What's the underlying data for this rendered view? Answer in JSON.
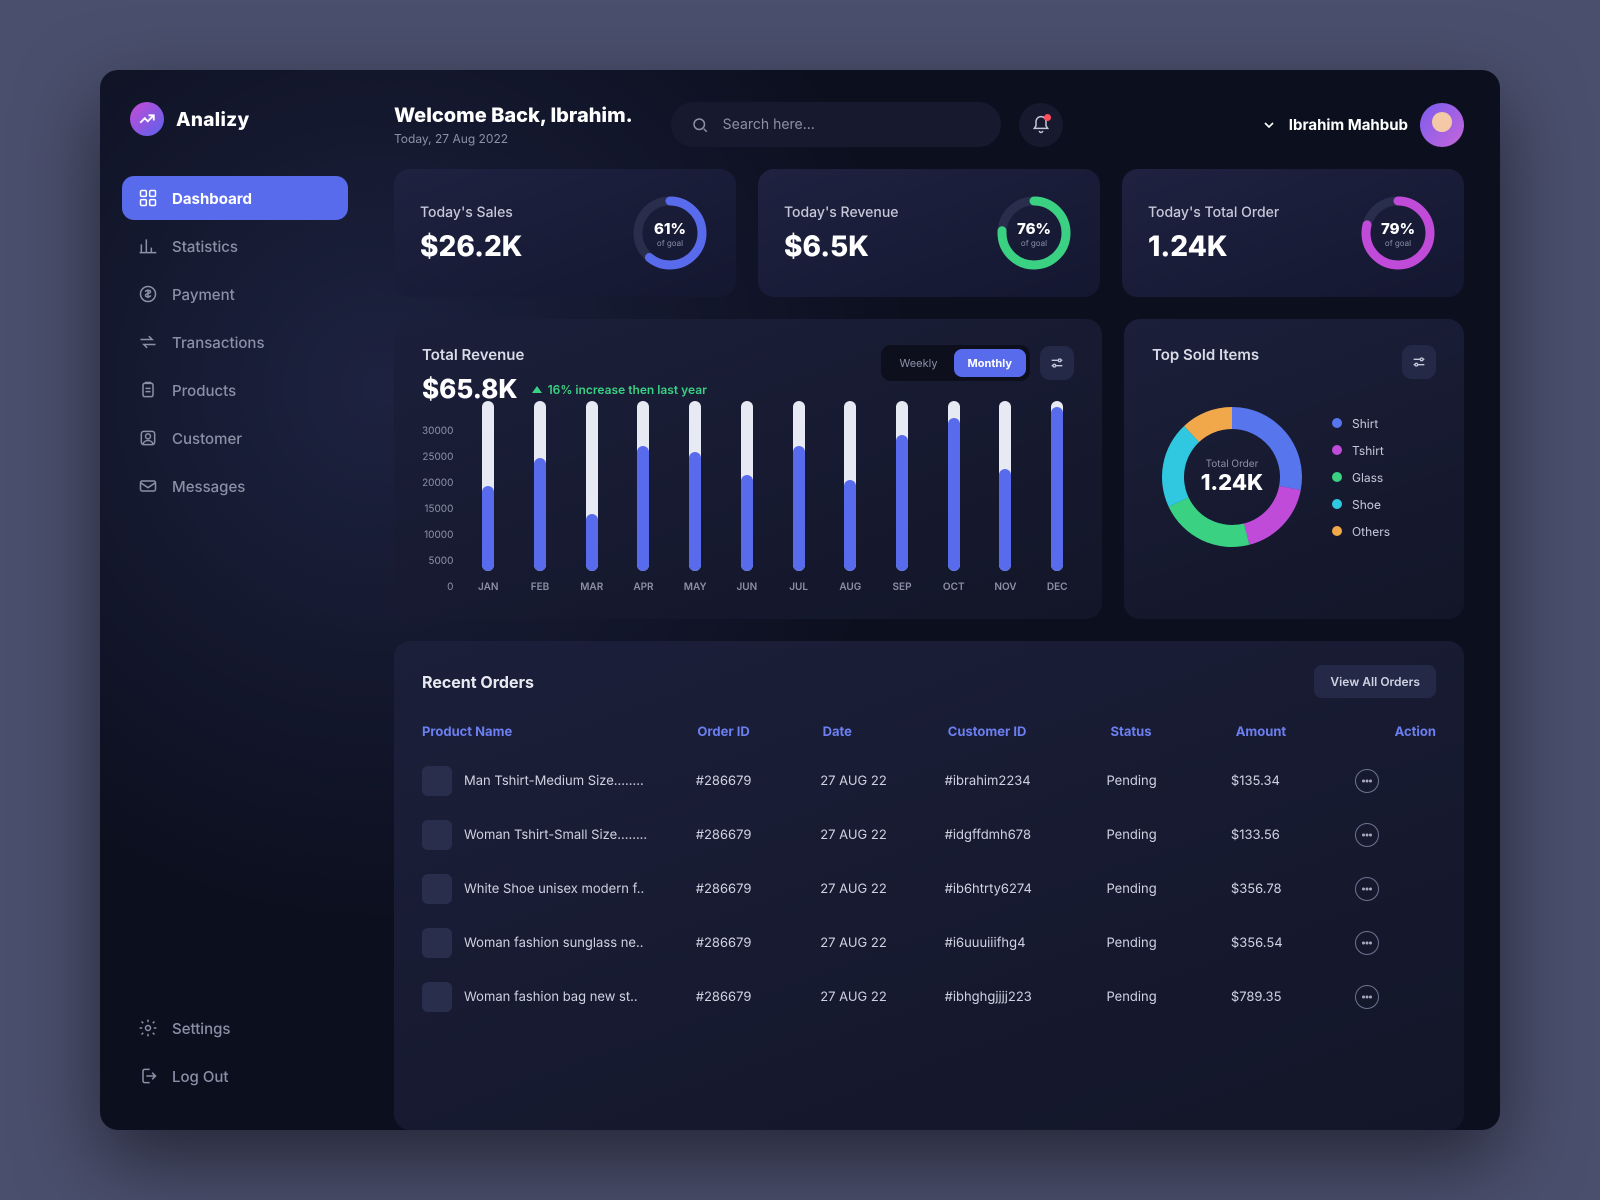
{
  "brand": "Analizy",
  "sidebar": {
    "items": [
      {
        "label": "Dashboard",
        "icon": "grid"
      },
      {
        "label": "Statistics",
        "icon": "stats"
      },
      {
        "label": "Payment",
        "icon": "dollar"
      },
      {
        "label": "Transactions",
        "icon": "swap"
      },
      {
        "label": "Products",
        "icon": "clipboard"
      },
      {
        "label": "Customer",
        "icon": "user"
      },
      {
        "label": "Messages",
        "icon": "mail"
      }
    ],
    "bottom": [
      {
        "label": "Settings",
        "icon": "gear"
      },
      {
        "label": "Log Out",
        "icon": "logout"
      }
    ]
  },
  "header": {
    "welcome": "Welcome Back, Ibrahim.",
    "date": "Today, 27 Aug 2022",
    "search_placeholder": "Search here...",
    "username": "Ibrahim Mahbub"
  },
  "stats": [
    {
      "label": "Today's Sales",
      "value": "$26.2K",
      "pct": "61%",
      "sub": "of goal",
      "color": "#586bed"
    },
    {
      "label": "Today's Revenue",
      "value": "$6.5K",
      "pct": "76%",
      "sub": "of goal",
      "color": "#3ad183"
    },
    {
      "label": "Today's Total Order",
      "value": "1.24K",
      "pct": "79%",
      "sub": "of goal",
      "color": "#c14bd9"
    }
  ],
  "revenue": {
    "title": "Total Revenue",
    "value": "$65.8K",
    "trend": "16% increase then last year",
    "toggle": [
      "Weekly",
      "Monthly"
    ]
  },
  "top_sold": {
    "title": "Top Sold Items",
    "center_label": "Total Order",
    "center_value": "1.24K",
    "legend": [
      {
        "label": "Shirt",
        "color": "#5775ed"
      },
      {
        "label": "Tshirt",
        "color": "#c14bd9"
      },
      {
        "label": "Glass",
        "color": "#3ad183"
      },
      {
        "label": "Shoe",
        "color": "#30c8e0"
      },
      {
        "label": "Others",
        "color": "#f0a84a"
      }
    ]
  },
  "orders": {
    "title": "Recent Orders",
    "view_all": "View All Orders",
    "columns": [
      "Product Name",
      "Order ID",
      "Date",
      "Customer ID",
      "Status",
      "Amount",
      "Action"
    ],
    "rows": [
      {
        "product": "Man Tshirt-Medium Size........",
        "id": "#286679",
        "date": "27 AUG 22",
        "cust": "#ibrahim2234",
        "status": "Pending",
        "amount": "$135.34"
      },
      {
        "product": "Woman Tshirt-Small Size........",
        "id": "#286679",
        "date": "27 AUG 22",
        "cust": "#idgffdmh678",
        "status": "Pending",
        "amount": "$133.56"
      },
      {
        "product": "White Shoe unisex modern f..",
        "id": "#286679",
        "date": "27 AUG 22",
        "cust": "#ib6htrty6274",
        "status": "Pending",
        "amount": "$356.78"
      },
      {
        "product": "Woman fashion sunglass ne..",
        "id": "#286679",
        "date": "27 AUG 22",
        "cust": "#i6uuuiiifhg4",
        "status": "Pending",
        "amount": "$356.54"
      },
      {
        "product": "Woman fashion bag new st..",
        "id": "#286679",
        "date": "27 AUG 22",
        "cust": "#ibhghgjjjj223",
        "status": "Pending",
        "amount": "$789.35"
      }
    ]
  },
  "chart_data": [
    {
      "type": "bar",
      "title": "Total Revenue",
      "ylabel": "",
      "ylim": [
        0,
        30000
      ],
      "yticks": [
        0,
        5000,
        10000,
        15000,
        20000,
        25000,
        30000
      ],
      "categories": [
        "JAN",
        "FEB",
        "MAR",
        "APR",
        "MAY",
        "JUN",
        "JUL",
        "AUG",
        "SEP",
        "OCT",
        "NOV",
        "DEC"
      ],
      "values": [
        15000,
        20000,
        10000,
        22000,
        21000,
        17000,
        22000,
        16000,
        24000,
        27000,
        18000,
        29000
      ]
    },
    {
      "type": "pie",
      "title": "Top Sold Items",
      "series": [
        {
          "name": "Shirt",
          "value": 28,
          "color": "#5775ed"
        },
        {
          "name": "Tshirt",
          "value": 18,
          "color": "#c14bd9"
        },
        {
          "name": "Glass",
          "value": 22,
          "color": "#3ad183"
        },
        {
          "name": "Shoe",
          "value": 20,
          "color": "#30c8e0"
        },
        {
          "name": "Others",
          "value": 12,
          "color": "#f0a84a"
        }
      ]
    }
  ]
}
